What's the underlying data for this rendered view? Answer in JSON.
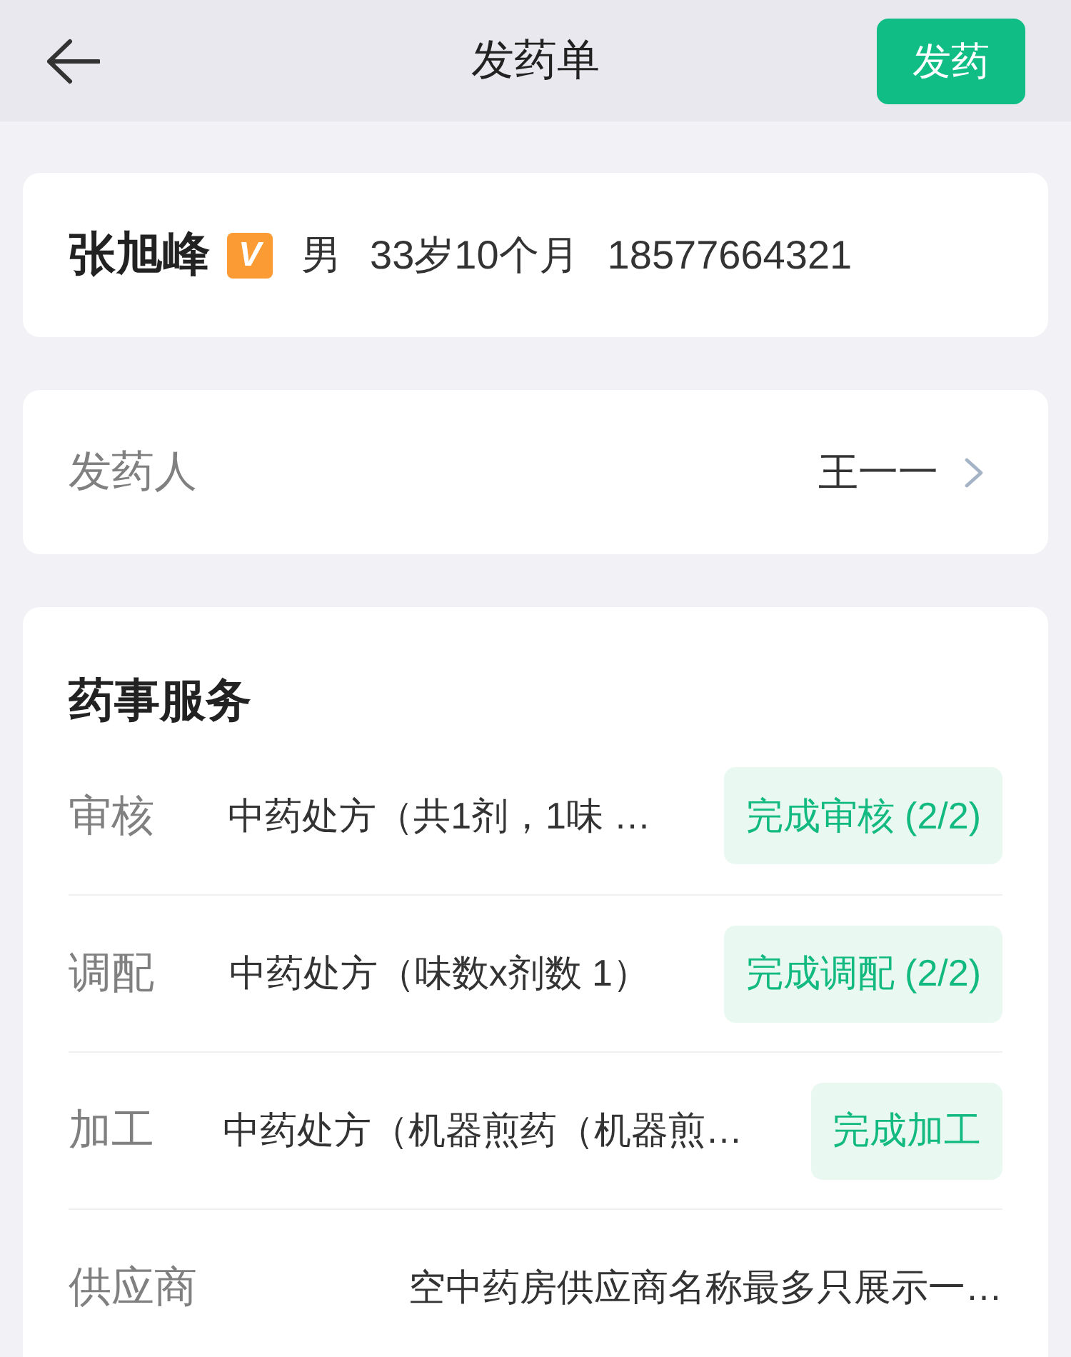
{
  "header": {
    "title": "发药单",
    "action": "发药"
  },
  "patient": {
    "name": "张旭峰",
    "badge": "V",
    "gender": "男",
    "age": "33岁10个月",
    "phone": "18577664321"
  },
  "dispenser": {
    "label": "发药人",
    "value": "王一一"
  },
  "services": {
    "title": "药事服务",
    "rows": [
      {
        "kind": "status",
        "label": "审核",
        "detail": "中药处方（共1剂，1味 …",
        "status": "完成审核 (2/2)"
      },
      {
        "kind": "status",
        "label": "调配",
        "detail": "中药处方（味数x剂数 1）",
        "status": "完成调配 (2/2)"
      },
      {
        "kind": "status",
        "label": "加工",
        "detail": "中药处方（机器煎药（机器煎…",
        "status": "完成加工"
      },
      {
        "kind": "plain",
        "label": "供应商",
        "detail": "空中药房供应商名称最多只展示一…"
      }
    ]
  }
}
